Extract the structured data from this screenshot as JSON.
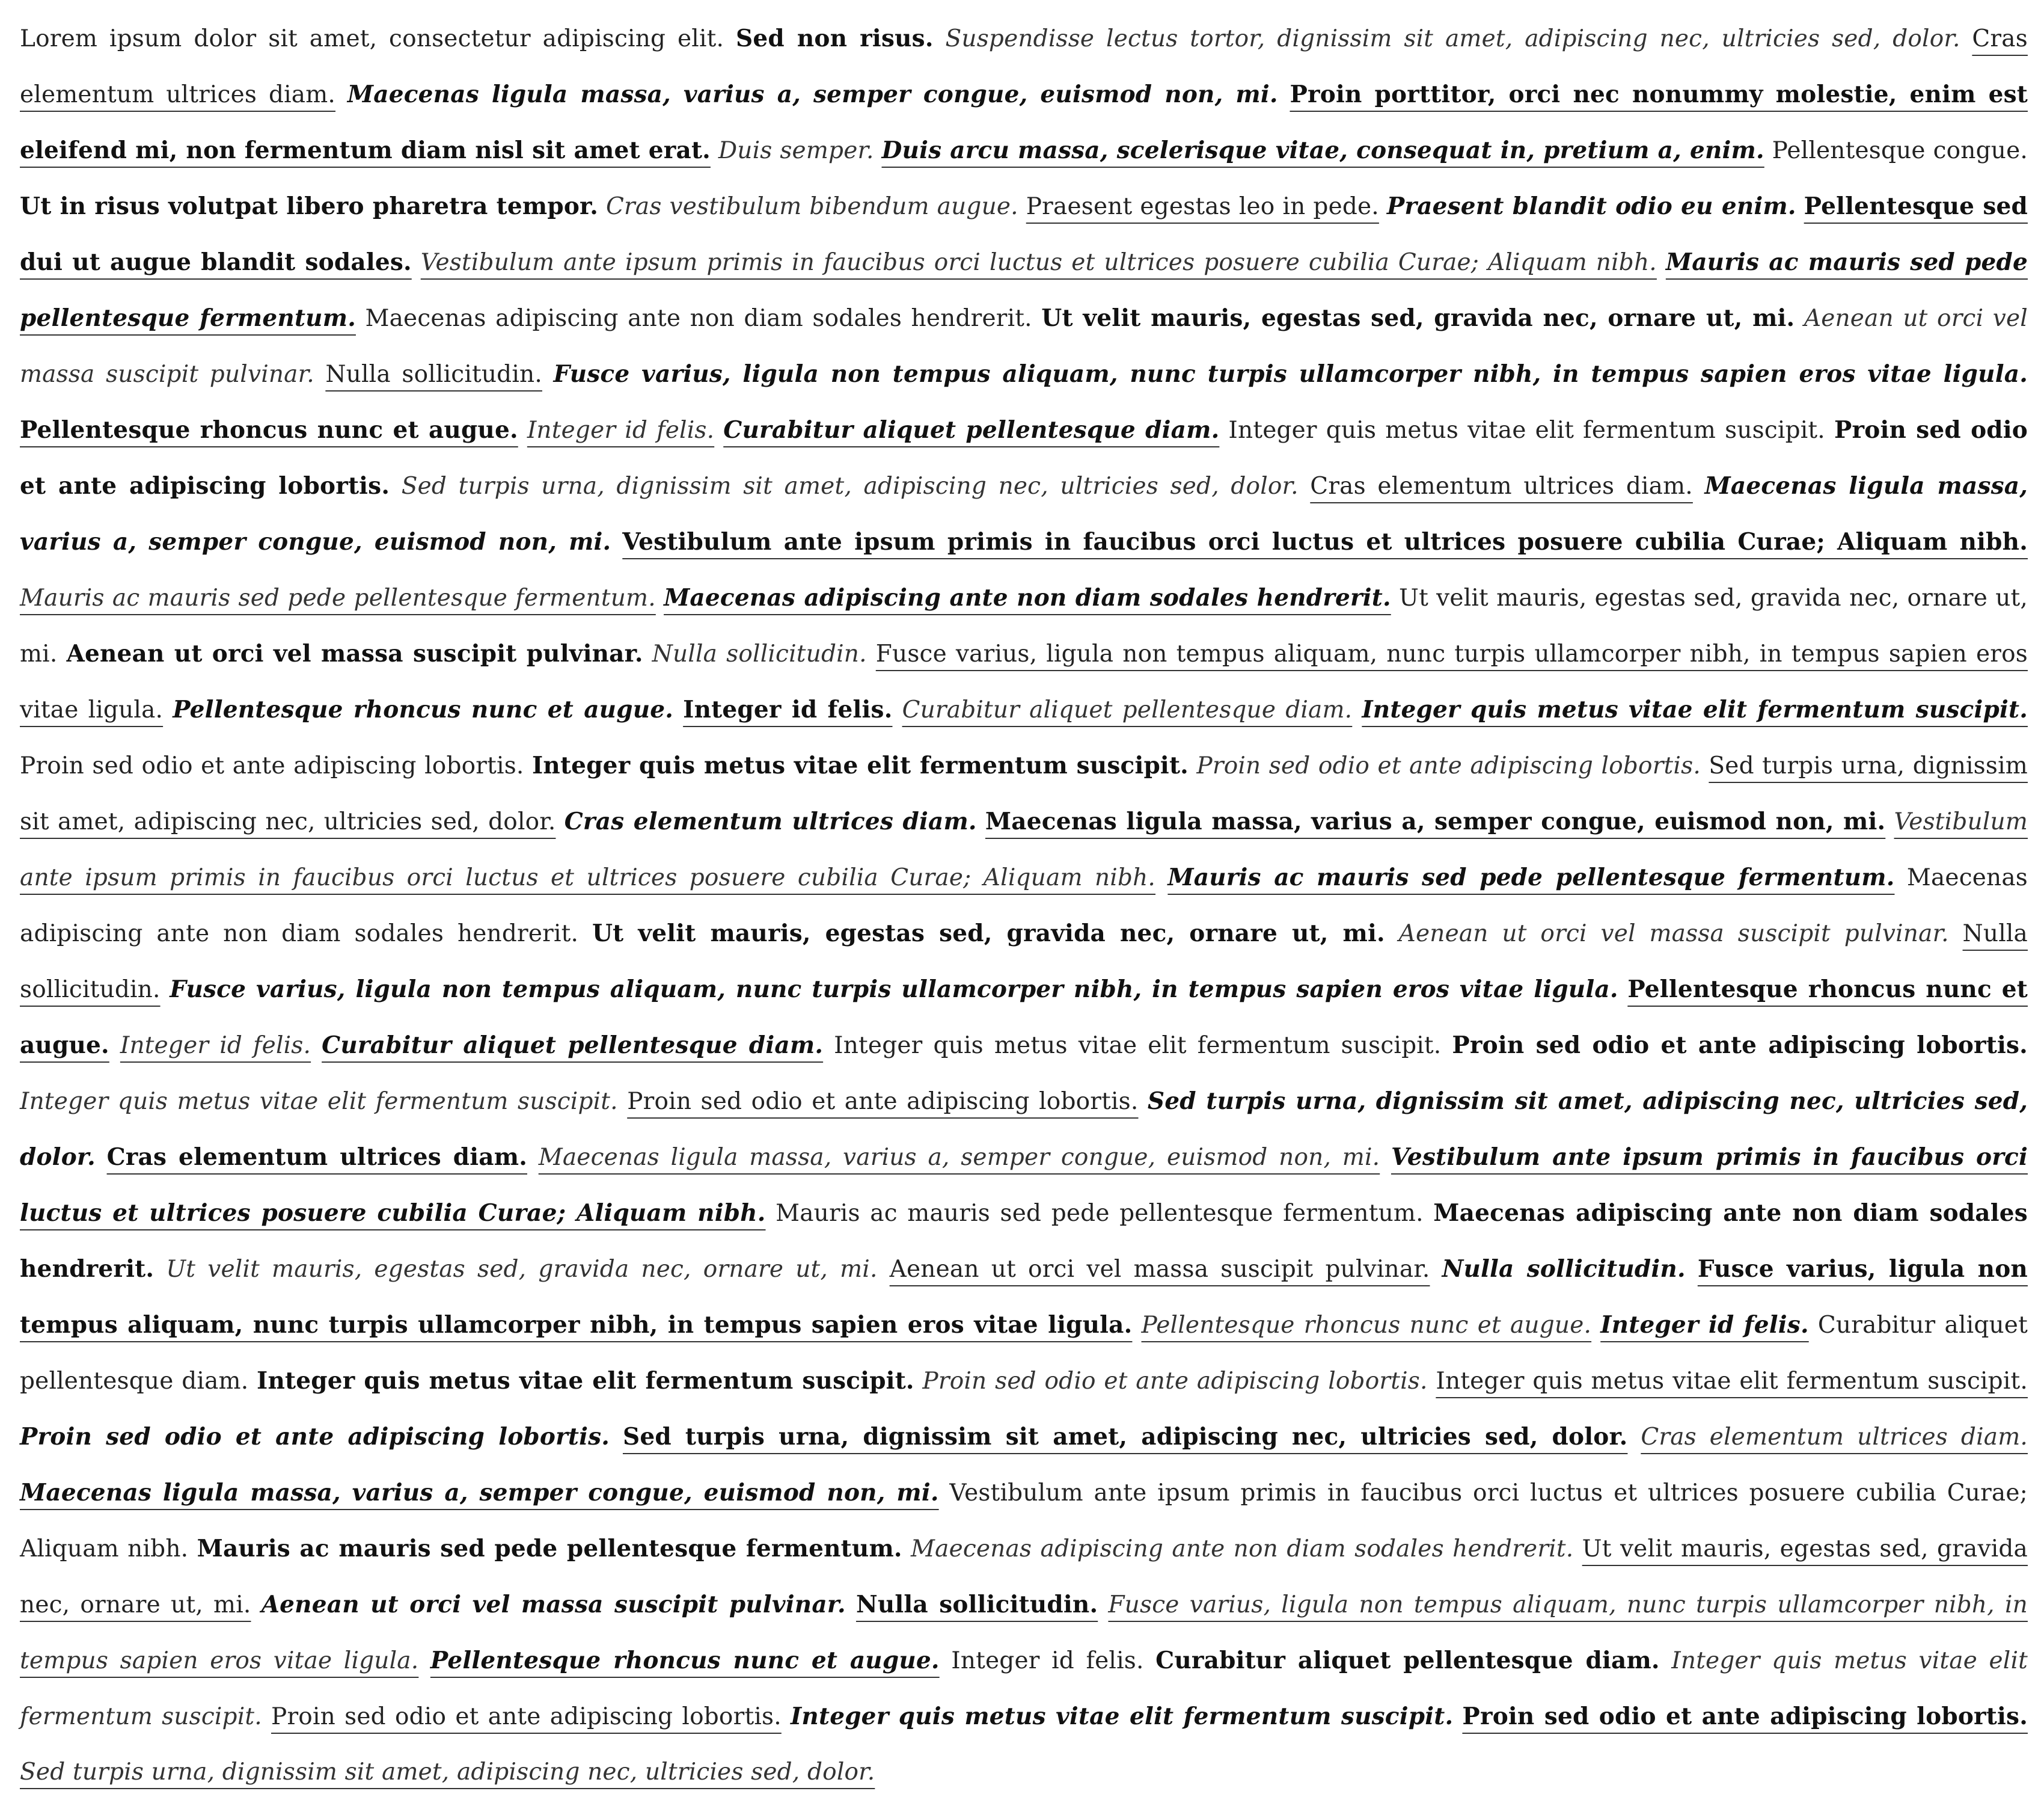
{
  "document": {
    "sentences": [
      {
        "text": "Lorem ipsum dolor sit amet, consectetur adipiscing elit.",
        "style": "plain",
        "underline": false
      },
      {
        "text": "Sed non risus.",
        "style": "bold",
        "underline": false
      },
      {
        "text": "Suspendisse lectus tortor, dignissim sit amet, adipiscing nec, ultricies sed, dolor.",
        "style": "italic",
        "underline": false
      },
      {
        "text": "Cras elementum ultrices diam.",
        "style": "plain",
        "underline": true
      },
      {
        "text": "Maecenas ligula massa, varius a, semper congue, euismod non, mi.",
        "style": "bolditalic",
        "underline": false
      },
      {
        "text": "Proin porttitor, orci nec nonummy molestie, enim est eleifend mi, non fermentum diam nisl sit amet erat.",
        "style": "bold",
        "underline": true
      },
      {
        "text": "Duis semper.",
        "style": "italic",
        "underline": false
      },
      {
        "text": "Duis arcu massa, scelerisque vitae, consequat in, pretium a, enim.",
        "style": "bolditalic",
        "underline": true
      },
      {
        "text": "Pellentesque congue.",
        "style": "plain",
        "underline": false
      },
      {
        "text": "Ut in risus volutpat libero pharetra tempor.",
        "style": "bold",
        "underline": false
      },
      {
        "text": "Cras vestibulum bibendum augue.",
        "style": "italic",
        "underline": false
      },
      {
        "text": "Praesent egestas leo in pede.",
        "style": "plain",
        "underline": true
      },
      {
        "text": "Praesent blandit odio eu enim.",
        "style": "bolditalic",
        "underline": false
      },
      {
        "text": "Pellentesque sed dui ut augue blandit sodales.",
        "style": "bold",
        "underline": true
      },
      {
        "text": "Vestibulum ante ipsum primis in faucibus orci luctus et ultrices posuere cubilia Curae; Aliquam nibh.",
        "style": "italic",
        "underline": true
      },
      {
        "text": "Mauris ac mauris sed pede pellentesque fermentum.",
        "style": "bolditalic",
        "underline": true
      },
      {
        "text": "Maecenas adipiscing ante non diam sodales hendrerit.",
        "style": "plain",
        "underline": false
      },
      {
        "text": "Ut velit mauris, egestas sed, gravida nec, ornare ut, mi.",
        "style": "bold",
        "underline": false
      },
      {
        "text": "Aenean ut orci vel massa suscipit pulvinar.",
        "style": "italic",
        "underline": false
      },
      {
        "text": "Nulla sollicitudin.",
        "style": "plain",
        "underline": true
      },
      {
        "text": "Fusce varius, ligula non tempus aliquam, nunc turpis ullamcorper nibh, in tempus sapien eros vitae ligula.",
        "style": "bolditalic",
        "underline": false
      },
      {
        "text": "Pellentesque rhoncus nunc et augue.",
        "style": "bold",
        "underline": true
      },
      {
        "text": "Integer id felis.",
        "style": "italic",
        "underline": true
      },
      {
        "text": "Curabitur aliquet pellentesque diam.",
        "style": "bolditalic",
        "underline": true
      },
      {
        "text": "Integer quis metus vitae elit fermentum suscipit.",
        "style": "plain",
        "underline": false
      },
      {
        "text": "Proin sed odio et ante adipiscing lobortis.",
        "style": "bold",
        "underline": false
      },
      {
        "text": "Sed turpis urna, dignissim sit amet, adipiscing nec, ultricies sed, dolor.",
        "style": "italic",
        "underline": false
      },
      {
        "text": "Cras elementum ultrices diam.",
        "style": "plain",
        "underline": true
      },
      {
        "text": "Maecenas ligula massa, varius a, semper congue, euismod non, mi.",
        "style": "bolditalic",
        "underline": false
      },
      {
        "text": "Vestibulum ante ipsum primis in faucibus orci luctus et ultrices posuere cubilia Curae; Aliquam nibh.",
        "style": "bold",
        "underline": true
      },
      {
        "text": "Mauris ac mauris sed pede pellentesque fermentum.",
        "style": "italic",
        "underline": true
      },
      {
        "text": "Maecenas adipiscing ante non diam sodales hendrerit.",
        "style": "bolditalic",
        "underline": true
      },
      {
        "text": "Ut velit mauris, egestas sed, gravida nec, ornare ut, mi.",
        "style": "plain",
        "underline": false
      },
      {
        "text": "Aenean ut orci vel massa suscipit pulvinar.",
        "style": "bold",
        "underline": false
      },
      {
        "text": "Nulla sollicitudin.",
        "style": "italic",
        "underline": false
      },
      {
        "text": "Fusce varius, ligula non tempus aliquam, nunc turpis ullamcorper nibh, in tempus sapien eros vitae ligula.",
        "style": "plain",
        "underline": true
      },
      {
        "text": "Pellentesque rhoncus nunc et augue.",
        "style": "bolditalic",
        "underline": false
      },
      {
        "text": "Integer id felis.",
        "style": "bold",
        "underline": true
      },
      {
        "text": "Curabitur aliquet pellentesque diam.",
        "style": "italic",
        "underline": true
      },
      {
        "text": "Integer quis metus vitae elit fermentum suscipit.",
        "style": "bolditalic",
        "underline": true
      },
      {
        "text": "Proin sed odio et ante adipiscing lobortis.",
        "style": "plain",
        "underline": false
      },
      {
        "text": "Integer quis metus vitae elit fermentum suscipit.",
        "style": "bold",
        "underline": false
      },
      {
        "text": "Proin sed odio et ante adipiscing lobortis.",
        "style": "italic",
        "underline": false
      },
      {
        "text": "Sed turpis urna, dignissim sit amet, adipiscing nec, ultricies sed, dolor.",
        "style": "plain",
        "underline": true
      },
      {
        "text": "Cras elementum ultrices diam.",
        "style": "bolditalic",
        "underline": false
      },
      {
        "text": "Maecenas ligula massa, varius a, semper congue, euismod non, mi.",
        "style": "bold",
        "underline": true
      },
      {
        "text": "Vestibulum ante ipsum primis in faucibus orci luctus et ultrices posuere cubilia Curae; Aliquam nibh.",
        "style": "italic",
        "underline": true
      },
      {
        "text": "Mauris ac mauris sed pede pellentesque fermentum.",
        "style": "bolditalic",
        "underline": true
      },
      {
        "text": "Maecenas adipiscing ante non diam sodales hendrerit.",
        "style": "plain",
        "underline": false
      },
      {
        "text": "Ut velit mauris, egestas sed, gravida nec, ornare ut, mi.",
        "style": "bold",
        "underline": false
      },
      {
        "text": "Aenean ut orci vel massa suscipit pulvinar.",
        "style": "italic",
        "underline": false
      },
      {
        "text": "Nulla sollicitudin.",
        "style": "plain",
        "underline": true
      },
      {
        "text": "Fusce varius, ligula non tempus aliquam, nunc turpis ullamcorper nibh, in tempus sapien eros vitae ligula.",
        "style": "bolditalic",
        "underline": false
      },
      {
        "text": "Pellentesque rhoncus nunc et augue.",
        "style": "bold",
        "underline": true
      },
      {
        "text": "Integer id felis.",
        "style": "italic",
        "underline": true
      },
      {
        "text": "Curabitur aliquet pellentesque diam.",
        "style": "bolditalic",
        "underline": true
      },
      {
        "text": "Integer quis metus vitae elit fermentum suscipit.",
        "style": "plain",
        "underline": false
      },
      {
        "text": "Proin sed odio et ante adipiscing lobortis.",
        "style": "bold",
        "underline": false
      },
      {
        "text": "Integer quis metus vitae elit fermentum suscipit.",
        "style": "italic",
        "underline": false
      },
      {
        "text": "Proin sed odio et ante adipiscing lobortis.",
        "style": "plain",
        "underline": true
      },
      {
        "text": "Sed turpis urna, dignissim sit amet, adipiscing nec, ultricies sed, dolor.",
        "style": "bolditalic",
        "underline": false
      },
      {
        "text": "Cras elementum ultrices diam.",
        "style": "bold",
        "underline": true
      },
      {
        "text": "Maecenas ligula massa, varius a, semper congue, euismod non, mi.",
        "style": "italic",
        "underline": true
      },
      {
        "text": "Vestibulum ante ipsum primis in faucibus orci luctus et ultrices posuere cubilia Curae; Aliquam nibh.",
        "style": "bolditalic",
        "underline": true
      },
      {
        "text": "Mauris ac mauris sed pede pellentesque fermentum.",
        "style": "plain",
        "underline": false
      },
      {
        "text": "Maecenas adipiscing ante non diam sodales hendrerit.",
        "style": "bold",
        "underline": false
      },
      {
        "text": "Ut velit mauris, egestas sed, gravida nec, ornare ut, mi.",
        "style": "italic",
        "underline": false
      },
      {
        "text": "Aenean ut orci vel massa suscipit pulvinar.",
        "style": "plain",
        "underline": true
      },
      {
        "text": "Nulla sollicitudin.",
        "style": "bolditalic",
        "underline": false
      },
      {
        "text": "Fusce varius, ligula non tempus aliquam, nunc turpis ullamcorper nibh, in tempus sapien eros vitae ligula.",
        "style": "bold",
        "underline": true
      },
      {
        "text": "Pellentesque rhoncus nunc et augue.",
        "style": "italic",
        "underline": true
      },
      {
        "text": "Integer id felis.",
        "style": "bolditalic",
        "underline": true
      },
      {
        "text": "Curabitur aliquet pellentesque diam.",
        "style": "plain",
        "underline": false
      },
      {
        "text": "Integer quis metus vitae elit fermentum suscipit.",
        "style": "bold",
        "underline": false
      },
      {
        "text": "Proin sed odio et ante adipiscing lobortis.",
        "style": "italic",
        "underline": false
      },
      {
        "text": "Integer quis metus vitae elit fermentum suscipit.",
        "style": "plain",
        "underline": true
      },
      {
        "text": "Proin sed odio et ante adipiscing lobortis.",
        "style": "bolditalic",
        "underline": false
      },
      {
        "text": "Sed turpis urna, dignissim sit amet, adipiscing nec, ultricies sed, dolor.",
        "style": "bold",
        "underline": true
      },
      {
        "text": "Cras elementum ultrices diam.",
        "style": "italic",
        "underline": true
      },
      {
        "text": "Maecenas ligula massa, varius a, semper congue, euismod non, mi.",
        "style": "bolditalic",
        "underline": true
      },
      {
        "text": "Vestibulum ante ipsum primis in faucibus orci luctus et ultrices posuere cubilia Curae; Aliquam nibh.",
        "style": "plain",
        "underline": false
      },
      {
        "text": "Mauris ac mauris sed pede pellentesque fermentum.",
        "style": "bold",
        "underline": false
      },
      {
        "text": "Maecenas adipiscing ante non diam sodales hendrerit.",
        "style": "italic",
        "underline": false
      },
      {
        "text": "Ut velit mauris, egestas sed, gravida nec, ornare ut, mi.",
        "style": "plain",
        "underline": true
      },
      {
        "text": "Aenean ut orci vel massa suscipit pulvinar.",
        "style": "bolditalic",
        "underline": false
      },
      {
        "text": "Nulla sollicitudin.",
        "style": "bold",
        "underline": true
      },
      {
        "text": "Fusce varius, ligula non tempus aliquam, nunc turpis ullamcorper nibh, in tempus sapien eros vitae ligula.",
        "style": "italic",
        "underline": true
      },
      {
        "text": "Pellentesque rhoncus nunc et augue.",
        "style": "bolditalic",
        "underline": true
      },
      {
        "text": "Integer id felis.",
        "style": "plain",
        "underline": false
      },
      {
        "text": "Curabitur aliquet pellentesque diam.",
        "style": "bold",
        "underline": false
      },
      {
        "text": "Integer quis metus vitae elit fermentum suscipit.",
        "style": "italic",
        "underline": false
      },
      {
        "text": "Proin sed odio et ante adipiscing lobortis.",
        "style": "plain",
        "underline": true
      },
      {
        "text": "Integer quis metus vitae elit fermentum suscipit.",
        "style": "bolditalic",
        "underline": false
      },
      {
        "text": "Proin sed odio et ante adipiscing lobortis.",
        "style": "bold",
        "underline": true
      },
      {
        "text": "Sed turpis urna, dignissim sit amet, adipiscing nec, ultricies sed, dolor.",
        "style": "italic",
        "underline": true
      }
    ]
  }
}
